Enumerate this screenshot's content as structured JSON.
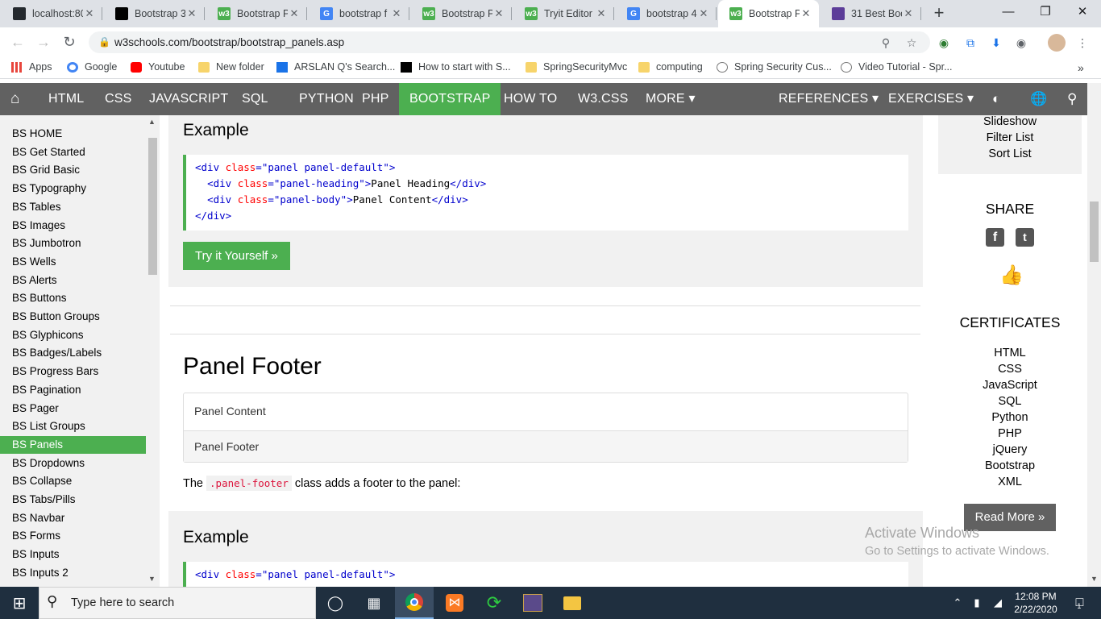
{
  "browser": {
    "tabs": [
      {
        "title": "localhost:80",
        "icon": "github-icon",
        "color": "#24292e"
      },
      {
        "title": "Bootstrap 3",
        "icon": "codepen-icon",
        "color": "#000000"
      },
      {
        "title": "Bootstrap P",
        "icon": "w3schools-icon",
        "color": "#4CAF50"
      },
      {
        "title": "bootstrap f",
        "icon": "google-icon",
        "color": "#4285F4"
      },
      {
        "title": "Bootstrap P",
        "icon": "w3schools-icon",
        "color": "#4CAF50"
      },
      {
        "title": "Tryit Editor",
        "icon": "w3schools-icon",
        "color": "#4CAF50"
      },
      {
        "title": "bootstrap 4",
        "icon": "google-icon",
        "color": "#4285F4"
      },
      {
        "title": "Bootstrap P",
        "icon": "w3schools-icon",
        "color": "#4CAF50",
        "active": true
      },
      {
        "title": "31 Best Boo",
        "icon": "colorlib-icon",
        "color": "#5c3d99"
      }
    ],
    "url": "w3schools.com/bootstrap/bootstrap_panels.asp",
    "bookmarks": [
      {
        "label": "Apps",
        "icon": "apps-grid-icon"
      },
      {
        "label": "Google",
        "icon": "google-icon"
      },
      {
        "label": "Youtube",
        "icon": "youtube-icon"
      },
      {
        "label": "New folder",
        "icon": "folder-icon"
      },
      {
        "label": "ARSLAN Q's Search...",
        "icon": "search-bookmark-icon"
      },
      {
        "label": "How to start with S...",
        "icon": "medium-icon"
      },
      {
        "label": "SpringSecurityMvc",
        "icon": "folder-icon"
      },
      {
        "label": "computing",
        "icon": "folder-icon"
      },
      {
        "label": "Spring Security Cus...",
        "icon": "bookmark-page-icon"
      },
      {
        "label": "Video Tutorial - Spr...",
        "icon": "video-icon"
      }
    ],
    "more_bookmarks": "»"
  },
  "nav": {
    "items": [
      "HTML",
      "CSS",
      "JAVASCRIPT",
      "SQL",
      "PYTHON",
      "PHP",
      "BOOTSTRAP",
      "HOW TO",
      "W3.CSS",
      "MORE ▾"
    ],
    "active": "BOOTSTRAP",
    "right": [
      "REFERENCES ▾",
      "EXERCISES ▾"
    ]
  },
  "sidebar": {
    "items": [
      "BS HOME",
      "BS Get Started",
      "BS Grid Basic",
      "BS Typography",
      "BS Tables",
      "BS Images",
      "BS Jumbotron",
      "BS Wells",
      "BS Alerts",
      "BS Buttons",
      "BS Button Groups",
      "BS Glyphicons",
      "BS Badges/Labels",
      "BS Progress Bars",
      "BS Pagination",
      "BS Pager",
      "BS List Groups",
      "BS Panels",
      "BS Dropdowns",
      "BS Collapse",
      "BS Tabs/Pills",
      "BS Navbar",
      "BS Forms",
      "BS Inputs",
      "BS Inputs 2"
    ],
    "active": "BS Panels"
  },
  "main": {
    "example1_heading": "Example",
    "example1_code": [
      {
        "parts": [
          [
            "tag",
            "<div "
          ],
          [
            "attr",
            "class"
          ],
          [
            "tag",
            "="
          ],
          [
            "val",
            "\"panel panel-default\""
          ],
          [
            "tag",
            ">"
          ]
        ]
      },
      {
        "parts": [
          [
            "sp",
            "  "
          ],
          [
            "tag",
            "<div "
          ],
          [
            "attr",
            "class"
          ],
          [
            "tag",
            "="
          ],
          [
            "val",
            "\"panel-heading\""
          ],
          [
            "tag",
            ">"
          ],
          [
            "txt",
            "Panel Heading"
          ],
          [
            "tag",
            "</div>"
          ]
        ]
      },
      {
        "parts": [
          [
            "sp",
            "  "
          ],
          [
            "tag",
            "<div "
          ],
          [
            "attr",
            "class"
          ],
          [
            "tag",
            "="
          ],
          [
            "val",
            "\"panel-body\""
          ],
          [
            "tag",
            ">"
          ],
          [
            "txt",
            "Panel Content"
          ],
          [
            "tag",
            "</div>"
          ]
        ]
      },
      {
        "parts": [
          [
            "tag",
            "</div>"
          ]
        ]
      }
    ],
    "try_button": "Try it Yourself »",
    "section_title": "Panel Footer",
    "panel_body": "Panel Content",
    "panel_footer": "Panel Footer",
    "desc_before": "The ",
    "desc_code": ".panel-footer",
    "desc_after": " class adds a footer to the panel:",
    "example2_heading": "Example",
    "example2_code": [
      {
        "parts": [
          [
            "tag",
            "<div "
          ],
          [
            "attr",
            "class"
          ],
          [
            "tag",
            "="
          ],
          [
            "val",
            "\"panel panel-default\""
          ],
          [
            "tag",
            ">"
          ]
        ]
      }
    ]
  },
  "right": {
    "top_links": [
      "Slideshow",
      "Filter List",
      "Sort List"
    ],
    "share_heading": "SHARE",
    "certificates_heading": "CERTIFICATES",
    "cert_links": [
      "HTML",
      "CSS",
      "JavaScript",
      "SQL",
      "Python",
      "PHP",
      "jQuery",
      "Bootstrap",
      "XML"
    ],
    "read_more": "Read More »"
  },
  "watermark": {
    "line1": "Activate Windows",
    "line2": "Go to Settings to activate Windows."
  },
  "taskbar": {
    "search_placeholder": "Type here to search",
    "time": "12:08 PM",
    "date": "2/22/2020",
    "notification_count": "1"
  }
}
